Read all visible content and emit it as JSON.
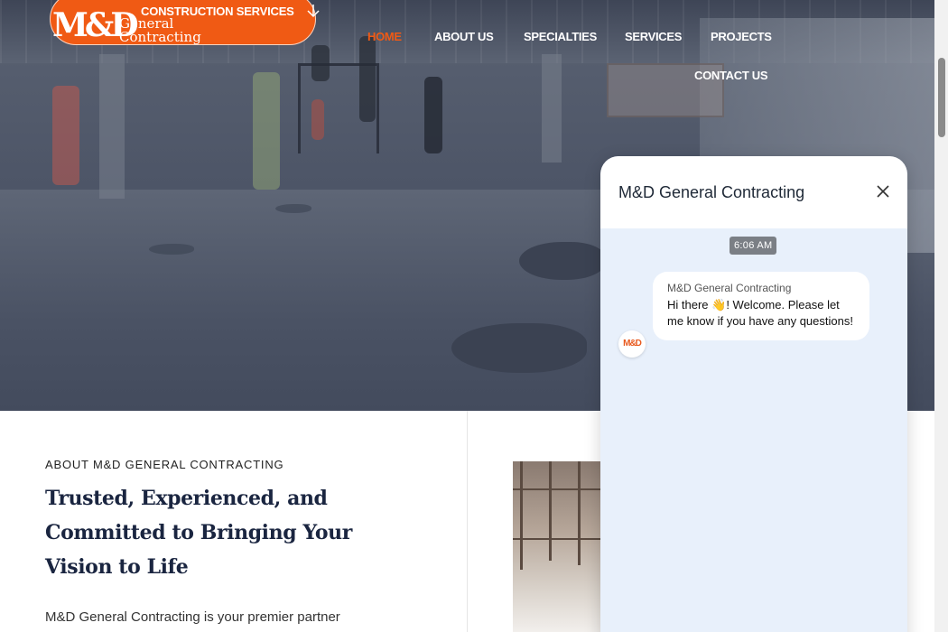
{
  "brand": {
    "logo_mark": "M&D",
    "logo_line1": "General",
    "logo_line2": "Contracting",
    "menu_label": "CONSTRUCTION SERVICES",
    "accent": "#F05A14"
  },
  "nav": {
    "items": [
      {
        "label": "HOME",
        "active": true
      },
      {
        "label": "ABOUT US"
      },
      {
        "label": "SPECIALTIES"
      },
      {
        "label": "SERVICES"
      },
      {
        "label": "PROJECTS"
      },
      {
        "label": "CONTACT US"
      }
    ]
  },
  "about": {
    "eyebrow": "ABOUT M&D GENERAL CONTRACTING",
    "title": "Trusted, Experienced, and Committed to Bringing Your Vision to Life",
    "body": "M&D General Contracting is your premier partner"
  },
  "chat": {
    "title": "M&D General Contracting",
    "timestamp": "6:06 AM",
    "sender": "M&D General Contracting",
    "message": "Hi there 👋! Welcome. Please let me know if you have any questions!",
    "avatar_text": "M&D",
    "background": "#E8F0FB"
  }
}
